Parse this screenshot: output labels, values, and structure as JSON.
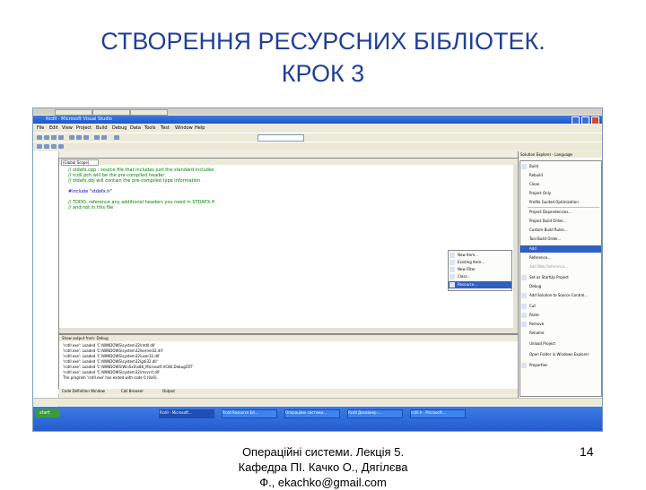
{
  "slide": {
    "title_line1": "СТВОРЕННЯ РЕСУРСНИХ БІБЛІОТЕК.",
    "title_line2": "КРОК 3",
    "footer_line1": "Операційні системи. Лекція 5.",
    "footer_line2": "Кафедра ПІ. Качко О., Дягілєва",
    "footer_line3": "Ф., ekachko@gmail.com",
    "page_number": "14"
  },
  "window": {
    "title": "Rcdll - Microsoft Visual Studio"
  },
  "menu": [
    "File",
    "Edit",
    "View",
    "Project",
    "Build",
    "Debug",
    "Data",
    "Tools",
    "Test",
    "Window",
    "Help"
  ],
  "editor": {
    "file_dropdown": "(Global Scope)",
    "code_lines": [
      "// stdafx.cpp : source file that includes just the standard includes",
      "// rcdll.pch will be the pre-compiled header",
      "// stdafx.obj will contain the pre-compiled type information",
      "",
      "#include \"stdafx.h\"",
      "",
      "// TODO: reference any additional headers you need in STDAFX.H",
      "// and not in this file"
    ]
  },
  "output": {
    "header": "Show output from: Debug",
    "lines": [
      "'rcdll.exe': Loaded 'C:\\WINDOWS\\system32\\ntdll.dll'",
      "'rcdll.exe': Loaded 'C:\\WINDOWS\\system32\\kernel32.dll'",
      "'rcdll.exe': Loaded 'C:\\WINDOWS\\system32\\user32.dll'",
      "'rcdll.exe': Loaded 'C:\\WINDOWS\\system32\\gdi32.dll'",
      "'rcdll.exe': Loaded 'C:\\WINDOWS\\WinSxS\\x86_Microsoft.VC80.DebugCRT'",
      "'rcdll.exe': Loaded 'C:\\WINDOWS\\system32\\msvcrt.dll'",
      "The program 'rcdll.exe' has exited with code 0 (0x0)."
    ],
    "tabs": [
      "Code Definition Window",
      "Call Browser",
      "Output"
    ]
  },
  "solution_explorer": {
    "title": "Solution Explorer - Language"
  },
  "context_menu": {
    "items": [
      "Build",
      "Rebuild",
      "Clean",
      "Project Only",
      "Profile Guided Optimization",
      "Project Dependencies...",
      "Project Build Order...",
      "Custom Build Rules...",
      "Tool Build Order...",
      "Add",
      "Reference...",
      "Add Web Reference...",
      "Set as StartUp Project",
      "Debug",
      "Add Solution to Source Control...",
      "Cut",
      "Paste",
      "Remove",
      "Rename",
      "Unload Project",
      "Open Folder in Windows Explorer",
      "Properties"
    ],
    "selected": "Add"
  },
  "add_submenu": {
    "items": [
      "New Item...",
      "Existing Item...",
      "New Filter",
      "Class...",
      "Resource..."
    ],
    "selected": "Resource..."
  },
  "taskbar": {
    "start": "start",
    "tasks": [
      "Rcdll - Microsoft...",
      "Rcdll Resource Ed...",
      "Операційні системи...",
      "Rcdll Дизайнер ...",
      "rcdll.h - Microsoft..."
    ]
  },
  "colors": {
    "title_blue": "#1f3f9a",
    "xp_blue": "#245bd0",
    "menu_select": "#2f5fc0"
  }
}
